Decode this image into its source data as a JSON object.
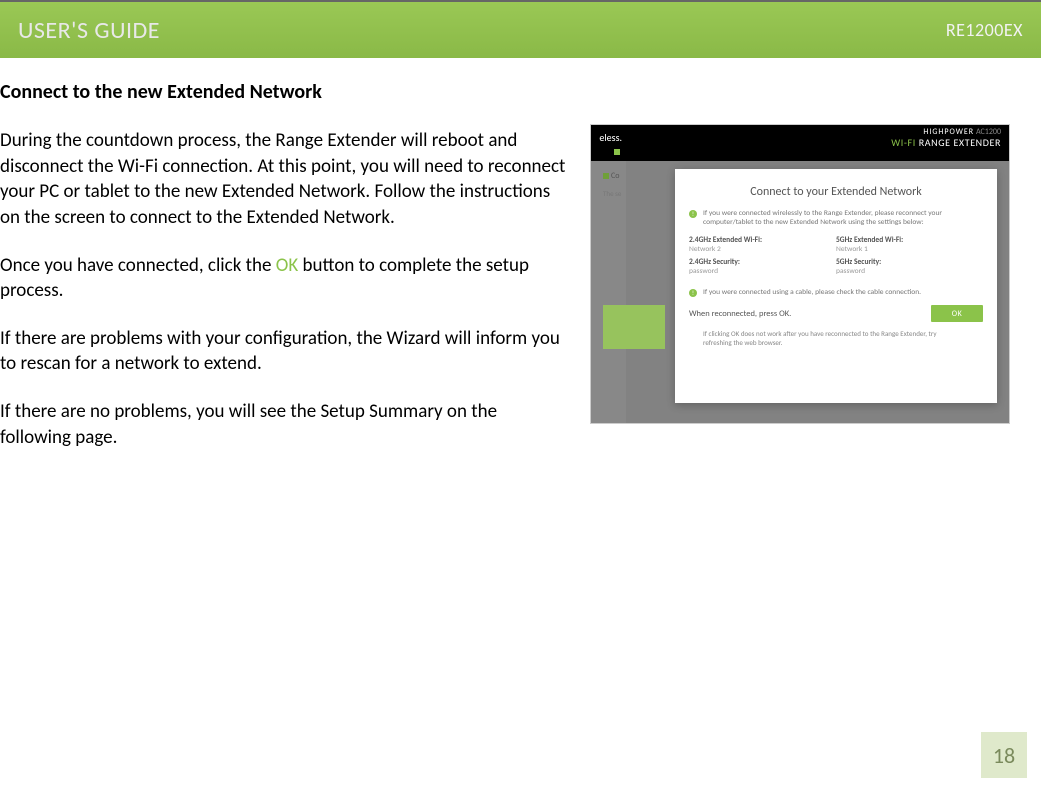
{
  "header": {
    "title": "USER'S GUIDE",
    "model": "RE1200EX"
  },
  "section": {
    "title": "Connect to the new Extended Network",
    "p1": "During the countdown process, the Range Extender will reboot and disconnect the Wi-Fi connection. At this point, you will need to reconnect your PC or tablet to the new Extended Network. Follow the instructions on the screen to connect to the Extended Network.",
    "p2a": "Once you have connected, click the ",
    "p2_ok": "OK",
    "p2b": " button to complete the setup process.",
    "p3": "If there are problems with your configuration, the Wizard will inform you to rescan for a network to extend.",
    "p4": "If there are no problems, you will see the Setup Summary on the following page."
  },
  "shot": {
    "strip_text": "eless.",
    "brand_hp": "HIGHPOWER",
    "brand_ac": "AC1200",
    "brand_wifi": "WI-FI",
    "brand_sub": "RANGE EXTENDER",
    "nav_co": "Co",
    "nav_sub": "The se",
    "modal_title": "Connect to your Extended Network",
    "line1": "If you were connected wirelessly to the Range Extender, please reconnect your computer/tablet to the new Extended Network using the settings below:",
    "col1_lbl1": "2.4GHz Extended Wi-Fi:",
    "col1_val1": "Network 2",
    "col2_lbl1": "5GHz Extended Wi-Fi:",
    "col2_val1": "Network 1",
    "col1_lbl2": "2.4GHz Security:",
    "col1_val2": "password",
    "col2_lbl2": "5GHz Security:",
    "col2_val2": "password",
    "line2": "If you were connected using a cable, please check the cable connection.",
    "reconnect": "When reconnected, press OK.",
    "ok_btn": "OK",
    "note": "If clicking OK does not work after you have reconnected to the Range Extender, try refreshing the web browser."
  },
  "page_number": "18"
}
